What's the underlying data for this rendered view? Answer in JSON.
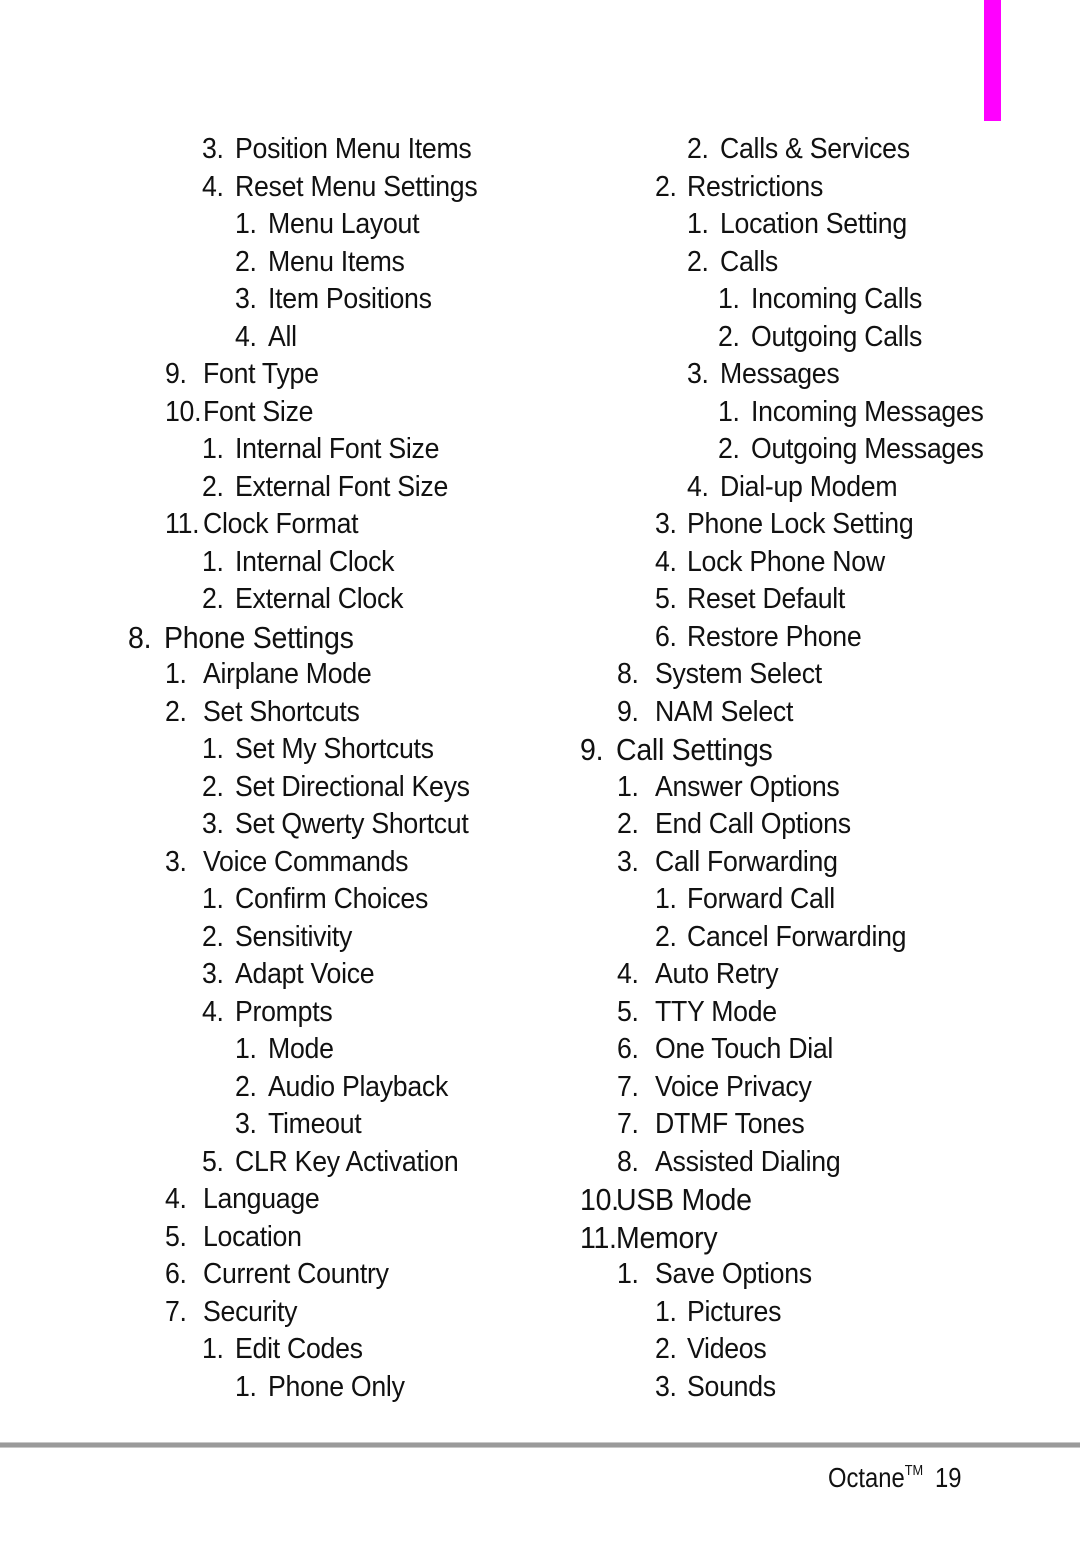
{
  "accent_color": "#ff00ff",
  "left_column": [
    {
      "num": "3.",
      "label": "Position Menu Items",
      "level": 2
    },
    {
      "num": "4.",
      "label": "Reset Menu Settings",
      "level": 2
    },
    {
      "num": "1.",
      "label": "Menu Layout",
      "level": 3
    },
    {
      "num": "2.",
      "label": "Menu Items",
      "level": 3
    },
    {
      "num": "3.",
      "label": "Item Positions",
      "level": 3
    },
    {
      "num": "4.",
      "label": "All",
      "level": 3
    },
    {
      "num": "9.",
      "label": "Font Type",
      "level": 1
    },
    {
      "num": "10.",
      "label": "Font Size",
      "level": 1
    },
    {
      "num": "1.",
      "label": "Internal Font Size",
      "level": 2
    },
    {
      "num": "2.",
      "label": "External Font Size",
      "level": 2
    },
    {
      "num": "11.",
      "label": "Clock Format",
      "level": 1
    },
    {
      "num": "1.",
      "label": "Internal Clock",
      "level": 2
    },
    {
      "num": "2.",
      "label": "External Clock",
      "level": 2
    },
    {
      "num": "8.",
      "label": "Phone Settings",
      "level": 0
    },
    {
      "num": "1.",
      "label": "Airplane Mode",
      "level": 1
    },
    {
      "num": "2.",
      "label": "Set Shortcuts",
      "level": 1
    },
    {
      "num": "1.",
      "label": "Set My Shortcuts",
      "level": 2
    },
    {
      "num": "2.",
      "label": "Set Directional Keys",
      "level": 2
    },
    {
      "num": "3.",
      "label": "Set Qwerty Shortcut",
      "level": 2
    },
    {
      "num": "3.",
      "label": "Voice Commands",
      "level": 1
    },
    {
      "num": "1.",
      "label": "Confirm Choices",
      "level": 2
    },
    {
      "num": "2.",
      "label": "Sensitivity",
      "level": 2
    },
    {
      "num": "3.",
      "label": "Adapt Voice",
      "level": 2
    },
    {
      "num": "4.",
      "label": "Prompts",
      "level": 2
    },
    {
      "num": "1.",
      "label": "Mode",
      "level": 3
    },
    {
      "num": "2.",
      "label": "Audio Playback",
      "level": 3
    },
    {
      "num": "3.",
      "label": "Timeout",
      "level": 3
    },
    {
      "num": "5.",
      "label": "CLR Key Activation",
      "level": 2
    },
    {
      "num": "4.",
      "label": "Language",
      "level": 1
    },
    {
      "num": "5.",
      "label": "Location",
      "level": 1
    },
    {
      "num": "6.",
      "label": "Current Country",
      "level": 1
    },
    {
      "num": "7.",
      "label": "Security",
      "level": 1
    },
    {
      "num": "1.",
      "label": "Edit Codes",
      "level": 2
    },
    {
      "num": "1.",
      "label": "Phone Only",
      "level": 3
    }
  ],
  "right_column": [
    {
      "num": "2.",
      "label": "Calls & Services",
      "level": 3
    },
    {
      "num": "2.",
      "label": "Restrictions",
      "level": 2
    },
    {
      "num": "1.",
      "label": "Location Setting",
      "level": 3
    },
    {
      "num": "2.",
      "label": "Calls",
      "level": 3
    },
    {
      "num": "1.",
      "label": "Incoming Calls",
      "level": 4
    },
    {
      "num": "2.",
      "label": "Outgoing Calls",
      "level": 4
    },
    {
      "num": "3.",
      "label": "Messages",
      "level": 3
    },
    {
      "num": "1.",
      "label": "Incoming Messages",
      "level": 4
    },
    {
      "num": "2.",
      "label": "Outgoing Messages",
      "level": 4
    },
    {
      "num": "4.",
      "label": "Dial-up Modem",
      "level": 3
    },
    {
      "num": "3.",
      "label": "Phone Lock Setting",
      "level": 2
    },
    {
      "num": "4.",
      "label": "Lock Phone Now",
      "level": 2
    },
    {
      "num": "5.",
      "label": "Reset Default",
      "level": 2
    },
    {
      "num": "6.",
      "label": "Restore Phone",
      "level": 2
    },
    {
      "num": "8.",
      "label": "System Select",
      "level": 1
    },
    {
      "num": "9.",
      "label": "NAM Select",
      "level": 1
    },
    {
      "num": "9.",
      "label": "Call Settings",
      "level": 0
    },
    {
      "num": "1.",
      "label": "Answer Options",
      "level": 1
    },
    {
      "num": "2.",
      "label": "End Call Options",
      "level": 1
    },
    {
      "num": "3.",
      "label": "Call Forwarding",
      "level": 1
    },
    {
      "num": "1.",
      "label": "Forward Call",
      "level": 2
    },
    {
      "num": "2.",
      "label": "Cancel Forwarding",
      "level": 2
    },
    {
      "num": "4.",
      "label": "Auto Retry",
      "level": 1
    },
    {
      "num": "5.",
      "label": "TTY Mode",
      "level": 1
    },
    {
      "num": "6.",
      "label": "One Touch Dial",
      "level": 1
    },
    {
      "num": "7.",
      "label": "Voice Privacy",
      "level": 1
    },
    {
      "num": "7.",
      "label": "DTMF Tones",
      "level": 1
    },
    {
      "num": "8.",
      "label": "Assisted Dialing",
      "level": 1
    },
    {
      "num": "10.",
      "label": "USB Mode",
      "level": 0
    },
    {
      "num": "11.",
      "label": "Memory",
      "level": 0
    },
    {
      "num": "1.",
      "label": "Save Options",
      "level": 1
    },
    {
      "num": "1.",
      "label": "Pictures",
      "level": 2
    },
    {
      "num": "2.",
      "label": "Videos",
      "level": 2
    },
    {
      "num": "3.",
      "label": "Sounds",
      "level": 2
    }
  ],
  "footer": {
    "product": "Octane",
    "trademark": "TM",
    "page_number": "19"
  }
}
